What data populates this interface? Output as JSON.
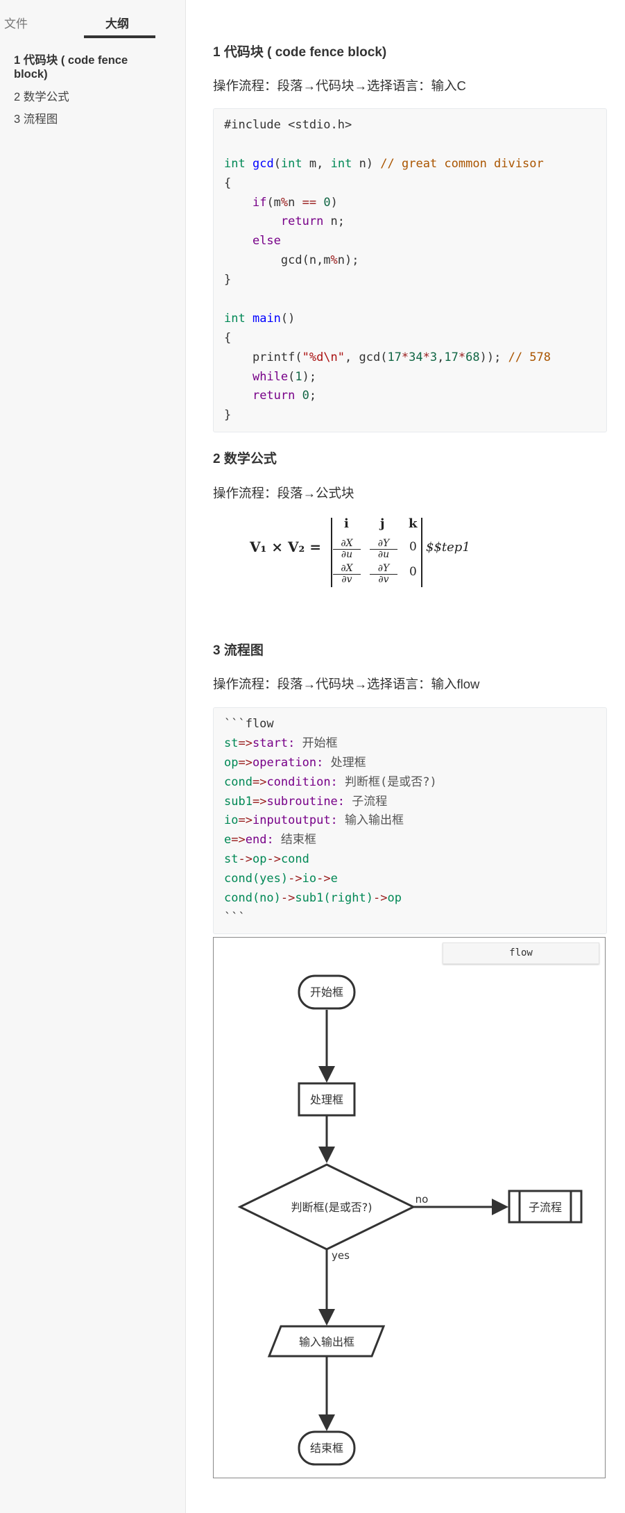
{
  "sidebar": {
    "tabs": [
      {
        "label": "文件"
      },
      {
        "label": "大纲"
      }
    ],
    "outline": [
      {
        "label": "1 代码块 ( code fence block)"
      },
      {
        "label": "2 数学公式"
      },
      {
        "label": "3 流程图"
      }
    ]
  },
  "sections": [
    {
      "heading": "1 代码块 ( code fence block)",
      "paragraph": "操作流程：段落→代码块→选择语言：输入C"
    },
    {
      "heading": "2 数学公式",
      "paragraph": "操作流程：段落→公式块"
    },
    {
      "heading": "3 流程图",
      "paragraph": "操作流程：段落→代码块→选择语言：输入flow"
    }
  ],
  "code_c": [
    [
      [
        "#include <stdio.h>",
        ""
      ]
    ],
    [],
    [
      [
        "int",
        "ty"
      ],
      [
        " ",
        ""
      ],
      [
        "gcd",
        "def"
      ],
      [
        "(",
        ""
      ],
      [
        "int",
        "ty"
      ],
      [
        " m, ",
        ""
      ],
      [
        "int",
        "ty"
      ],
      [
        " n) ",
        ""
      ],
      [
        "// great common divisor",
        "cm"
      ]
    ],
    [
      [
        "{",
        ""
      ]
    ],
    [
      [
        "    ",
        ""
      ],
      [
        "if",
        "kw"
      ],
      [
        "(m",
        ""
      ],
      [
        "%",
        "op"
      ],
      [
        "n ",
        ""
      ],
      [
        "==",
        "op"
      ],
      [
        " ",
        ""
      ],
      [
        "0",
        "num"
      ],
      [
        ")",
        ""
      ]
    ],
    [
      [
        "        ",
        ""
      ],
      [
        "return",
        "kw"
      ],
      [
        " n;",
        ""
      ]
    ],
    [
      [
        "    ",
        ""
      ],
      [
        "else",
        "kw"
      ]
    ],
    [
      [
        "        gcd(n,m",
        ""
      ],
      [
        "%",
        "op"
      ],
      [
        "n);",
        ""
      ]
    ],
    [
      [
        "}",
        ""
      ]
    ],
    [],
    [
      [
        "int",
        "ty"
      ],
      [
        " ",
        ""
      ],
      [
        "main",
        "def"
      ],
      [
        "()",
        ""
      ]
    ],
    [
      [
        "{",
        ""
      ]
    ],
    [
      [
        "    printf(",
        ""
      ],
      [
        "\"%d\\n\"",
        "str"
      ],
      [
        ", gcd(",
        ""
      ],
      [
        "17",
        "num"
      ],
      [
        "*",
        "op"
      ],
      [
        "34",
        "num"
      ],
      [
        "*",
        "op"
      ],
      [
        "3",
        "num"
      ],
      [
        ",",
        ""
      ],
      [
        "17",
        "num"
      ],
      [
        "*",
        "op"
      ],
      [
        "68",
        "num"
      ],
      [
        ")); ",
        ""
      ],
      [
        "// 578",
        "cm"
      ]
    ],
    [
      [
        "    ",
        ""
      ],
      [
        "while",
        "kw"
      ],
      [
        "(",
        ""
      ],
      [
        "1",
        "num"
      ],
      [
        ");",
        ""
      ]
    ],
    [
      [
        "    ",
        ""
      ],
      [
        "return",
        "kw"
      ],
      [
        " ",
        ""
      ],
      [
        "0",
        "num"
      ],
      [
        ";",
        ""
      ]
    ],
    [
      [
        "}",
        ""
      ]
    ]
  ],
  "code_flow": [
    [
      [
        "```flow",
        ""
      ]
    ],
    [
      [
        "st",
        "var"
      ],
      [
        "=>",
        "op"
      ],
      [
        "start:",
        "prop"
      ],
      [
        " 开始框",
        "zh"
      ]
    ],
    [
      [
        "op",
        "var"
      ],
      [
        "=>",
        "op"
      ],
      [
        "operation:",
        "prop"
      ],
      [
        " 处理框",
        "zh"
      ]
    ],
    [
      [
        "cond",
        "var"
      ],
      [
        "=>",
        "op"
      ],
      [
        "condition:",
        "prop"
      ],
      [
        " 判断框(是或否?)",
        "zh"
      ]
    ],
    [
      [
        "sub1",
        "var"
      ],
      [
        "=>",
        "op"
      ],
      [
        "subroutine:",
        "prop"
      ],
      [
        " 子流程",
        "zh"
      ]
    ],
    [
      [
        "io",
        "var"
      ],
      [
        "=>",
        "op"
      ],
      [
        "inputoutput:",
        "prop"
      ],
      [
        " 输入输出框",
        "zh"
      ]
    ],
    [
      [
        "e",
        "var"
      ],
      [
        "=>",
        "op"
      ],
      [
        "end:",
        "prop"
      ],
      [
        " 结束框",
        "zh"
      ]
    ],
    [
      [
        "st",
        "var"
      ],
      [
        "->",
        "op"
      ],
      [
        "op",
        "var"
      ],
      [
        "->",
        "op"
      ],
      [
        "cond",
        "var"
      ]
    ],
    [
      [
        "cond(yes)",
        "var"
      ],
      [
        "->",
        "op"
      ],
      [
        "io",
        "var"
      ],
      [
        "->",
        "op"
      ],
      [
        "e",
        "var"
      ]
    ],
    [
      [
        "cond(no)",
        "var"
      ],
      [
        "->",
        "op"
      ],
      [
        "sub1(right)",
        "var"
      ],
      [
        "->",
        "op"
      ],
      [
        "op",
        "var"
      ]
    ],
    [
      [
        "```",
        ""
      ]
    ]
  ],
  "formula": {
    "lhs": "V₁ × V₂ =",
    "row1": [
      "i",
      "j",
      "k"
    ],
    "row2": [
      {
        "num": "∂X",
        "den": "∂u"
      },
      {
        "num": "∂Y",
        "den": "∂u"
      },
      "0"
    ],
    "row3": [
      {
        "num": "∂X",
        "den": "∂v"
      },
      {
        "num": "∂Y",
        "den": "∂v"
      },
      "0"
    ],
    "tail": "$$tep1"
  },
  "diagram": {
    "language_button": "flow",
    "nodes": {
      "start": "开始框",
      "operation": "处理框",
      "condition": "判断框(是或否?)",
      "subroutine": "子流程",
      "inputoutput": "输入输出框",
      "end": "结束框"
    },
    "labels": {
      "no": "no",
      "yes": "yes"
    }
  }
}
